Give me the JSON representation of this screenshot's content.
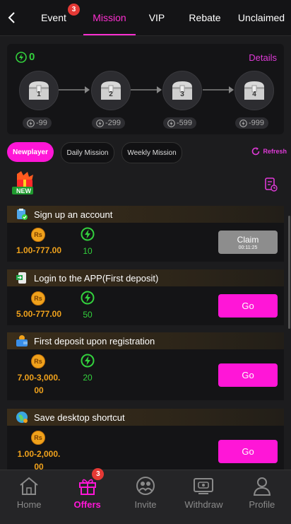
{
  "tabs": [
    {
      "label": "Event",
      "badge": "3"
    },
    {
      "label": "Mission",
      "active": true
    },
    {
      "label": "VIP"
    },
    {
      "label": "Rebate"
    },
    {
      "label": "Unclaimed"
    }
  ],
  "progress": {
    "points": "0",
    "details_label": "Details",
    "chests": [
      {
        "number": "1",
        "cost": "-99"
      },
      {
        "number": "2",
        "cost": "-299"
      },
      {
        "number": "3",
        "cost": "-599"
      },
      {
        "number": "4",
        "cost": "-999"
      }
    ]
  },
  "filters": {
    "items": [
      "Newplayer",
      "Daily Mission",
      "Weekly Mission"
    ],
    "active": "Newplayer",
    "refresh_label": "Refresh"
  },
  "new_badge": "NEW",
  "tasks": [
    {
      "title": "Sign up an account",
      "coin_label": "Rs",
      "amount": "1.00-777.00",
      "points": "10",
      "button": "Claim",
      "timer": "00:11:25"
    },
    {
      "title": "Login to the APP(First deposit)",
      "coin_label": "Rs",
      "amount": "5.00-777.00",
      "points": "50",
      "button": "Go"
    },
    {
      "title": "First deposit upon registration",
      "coin_label": "Rs",
      "amount_line1": "7.00-3,000.",
      "amount_line2": "00",
      "points": "20",
      "button": "Go"
    },
    {
      "title": "Save desktop shortcut",
      "coin_label": "Rs",
      "amount_line1": "1.00-2,000.",
      "amount_line2": "00",
      "button": "Go"
    }
  ],
  "bottom_nav": [
    {
      "label": "Home"
    },
    {
      "label": "Offers",
      "active": true,
      "badge": "3"
    },
    {
      "label": "Invite"
    },
    {
      "label": "Withdraw"
    },
    {
      "label": "Profile"
    }
  ],
  "colors": {
    "accent": "#ff16d7",
    "green": "#33d13d",
    "gold": "#f0a21c",
    "background": "#1c1c1e"
  }
}
